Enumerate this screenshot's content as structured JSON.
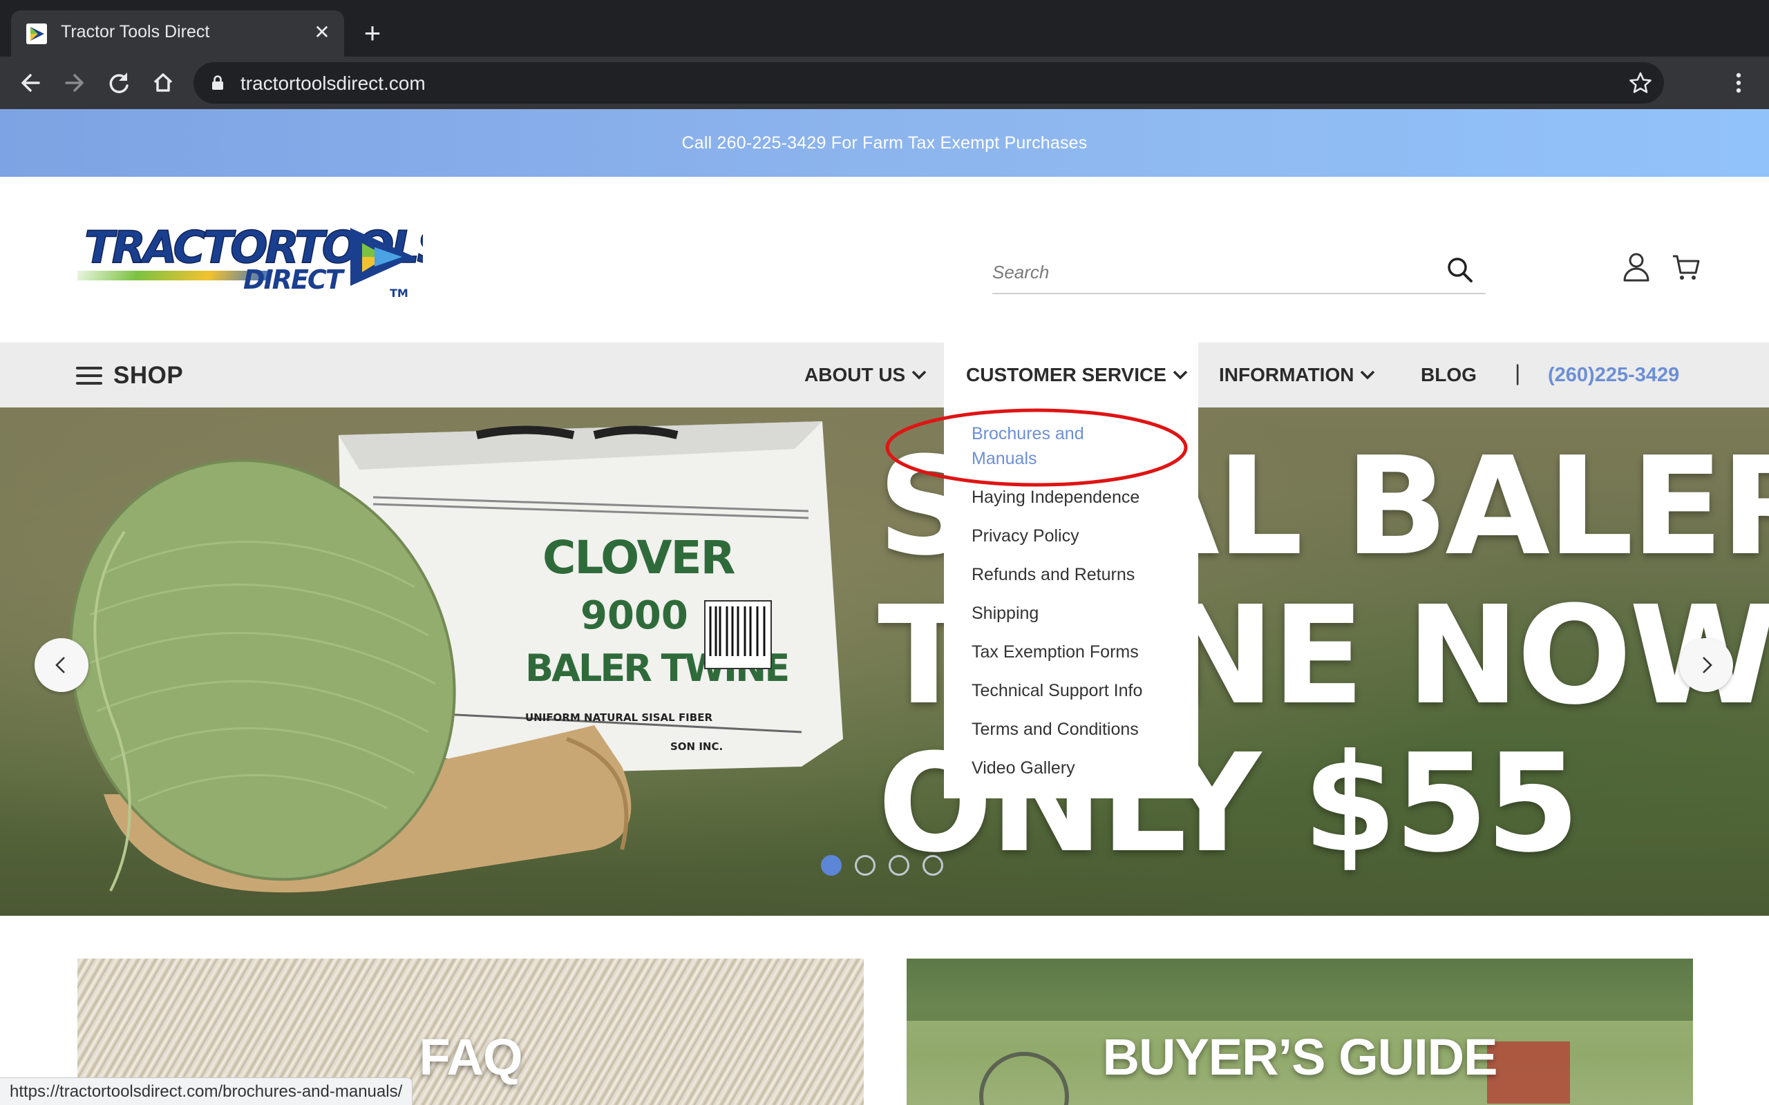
{
  "browser": {
    "tab_title": "Tractor Tools Direct",
    "new_tab_symbol": "+",
    "close_symbol": "✕",
    "url": "tractortoolsdirect.com",
    "status_url": "https://tractortoolsdirect.com/brochures-and-manuals/"
  },
  "promo": {
    "text": "Call 260-225-3429 For Farm Tax Exempt Purchases"
  },
  "header": {
    "logo": {
      "line1": "TRACTORTOOLS",
      "line2": "DIRECT",
      "tm": "TM"
    },
    "search_placeholder": "Search"
  },
  "nav": {
    "shop_label": "SHOP",
    "items": [
      {
        "label": "ABOUT US"
      },
      {
        "label": "CUSTOMER SERVICE"
      },
      {
        "label": "INFORMATION"
      },
      {
        "label": "BLOG"
      }
    ],
    "separator": "|",
    "phone": "(260)225-3429"
  },
  "dropdown": {
    "items": [
      {
        "label": "Brochures and"
      },
      {
        "label": "Manuals"
      },
      {
        "label": "Haying Independence"
      },
      {
        "label": "Privacy Policy"
      },
      {
        "label": "Refunds and Returns"
      },
      {
        "label": "Shipping"
      },
      {
        "label": "Tax Exemption Forms"
      },
      {
        "label": "Technical Support Info"
      },
      {
        "label": "Terms and Conditions"
      },
      {
        "label": "Video Gallery"
      }
    ]
  },
  "hero": {
    "line1": "SISAL BALER",
    "line2": "TWINE NOW",
    "line3": "ONLY $55",
    "package_text": {
      "brand": "CLOVER",
      "number": "9000",
      "product": "BALER TWINE",
      "fiber": "UNIFORM NATURAL SISAL FIBER",
      "maker": "SON INC."
    },
    "slide_count": 4,
    "active_slide": 1
  },
  "tiles": [
    {
      "title": "FAQ"
    },
    {
      "title": "BUYER’S GUIDE"
    }
  ],
  "colors": {
    "chrome_dark": "#202124",
    "promo_blue": "#8eb6ee",
    "accent_blue": "#6c8fd6",
    "annotation_red": "#e01414"
  }
}
